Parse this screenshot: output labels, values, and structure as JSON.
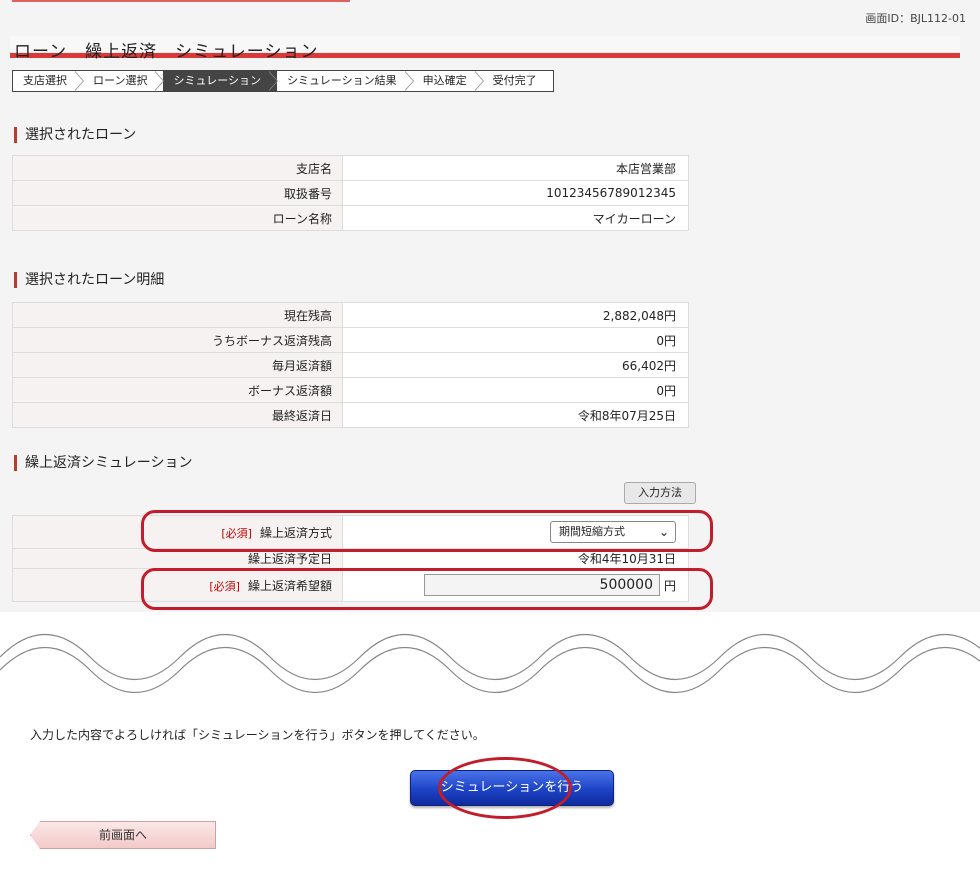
{
  "screen_id": "画面ID：BJL112-01",
  "page_title": "ローン　繰上返済　シミュレーション",
  "steps": [
    {
      "label": "支店選択",
      "active": false
    },
    {
      "label": "ローン選択",
      "active": false
    },
    {
      "label": "シミュレーション",
      "active": true
    },
    {
      "label": "シミュレーション結果",
      "active": false
    },
    {
      "label": "申込確定",
      "active": false
    },
    {
      "label": "受付完了",
      "active": false
    }
  ],
  "selected_loan": {
    "heading": "選択されたローン",
    "rows": [
      {
        "label": "支店名",
        "value": "本店営業部"
      },
      {
        "label": "取扱番号",
        "value": "10123456789012345"
      },
      {
        "label": "ローン名称",
        "value": "マイカーローン"
      }
    ]
  },
  "loan_details": {
    "heading": "選択されたローン明細",
    "rows": [
      {
        "label": "現在残高",
        "value": "2,882,048円"
      },
      {
        "label": "うちボーナス返済残高",
        "value": "0円"
      },
      {
        "label": "毎月返済額",
        "value": "66,402円"
      },
      {
        "label": "ボーナス返済額",
        "value": "0円"
      },
      {
        "label": "最終返済日",
        "value": "令和8年07月25日"
      }
    ]
  },
  "simulation": {
    "heading": "繰上返済シミュレーション",
    "input_method_label": "入力方法",
    "required_tag": "[必須]",
    "method_label": "繰上返済方式",
    "method_value": "期間短縮方式",
    "date_label": "繰上返済予定日",
    "date_value": "令和4年10月31日",
    "amount_label": "繰上返済希望額",
    "amount_value": "500000",
    "amount_unit": "円"
  },
  "instruction": "入力した内容でよろしければ「シミュレーションを行う」ボタンを押してください。",
  "simulate_button": "シミュレーションを行う",
  "back_button": "前画面へ",
  "colors": {
    "accent_red": "#d83a3a",
    "highlight_red": "#c31c2a",
    "primary_button_blue": "#1d43c6"
  }
}
